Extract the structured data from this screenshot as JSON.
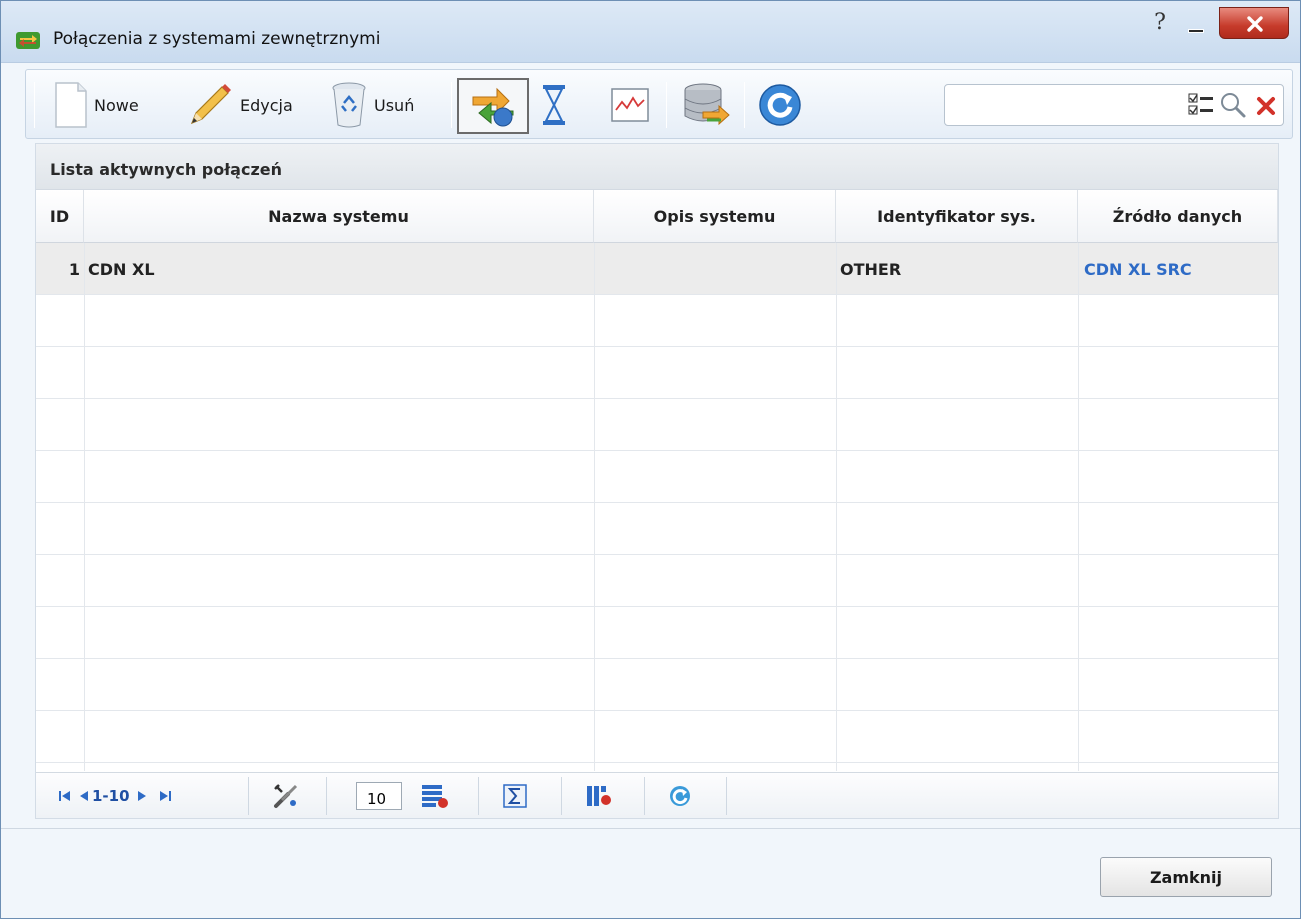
{
  "window": {
    "title": "Połączenia z systemami zewnętrznymi",
    "help_glyph": "?",
    "app_icon": "arrows-exchange-icon"
  },
  "toolbar": {
    "new_label": "Nowe",
    "edit_label": "Edycja",
    "delete_label": "Usuń",
    "icons": [
      "new-document-icon",
      "pencil-icon",
      "recycle-bin-icon",
      "connection-sync-icon",
      "hourglass-icon",
      "chart-icon",
      "database-sync-icon",
      "refresh-icon"
    ],
    "search": {
      "value": "",
      "placeholder": ""
    }
  },
  "panel": {
    "title": "Lista aktywnych połączeń",
    "columns": {
      "id": "ID",
      "name": "Nazwa systemu",
      "description": "Opis systemu",
      "identifier": "Identyfikator sys.",
      "source": "Źródło danych"
    },
    "rows": [
      {
        "id": "1",
        "name": "CDN XL",
        "description": "",
        "identifier": "OTHER",
        "source": "CDN XL SRC"
      }
    ]
  },
  "pager": {
    "range_label": "1-10",
    "page_size": "10"
  },
  "footer": {
    "close_label": "Zamknij"
  },
  "colors": {
    "link": "#2e6bc6",
    "close_red": "#c63b2b",
    "pager_blue": "#1f4fa3"
  }
}
